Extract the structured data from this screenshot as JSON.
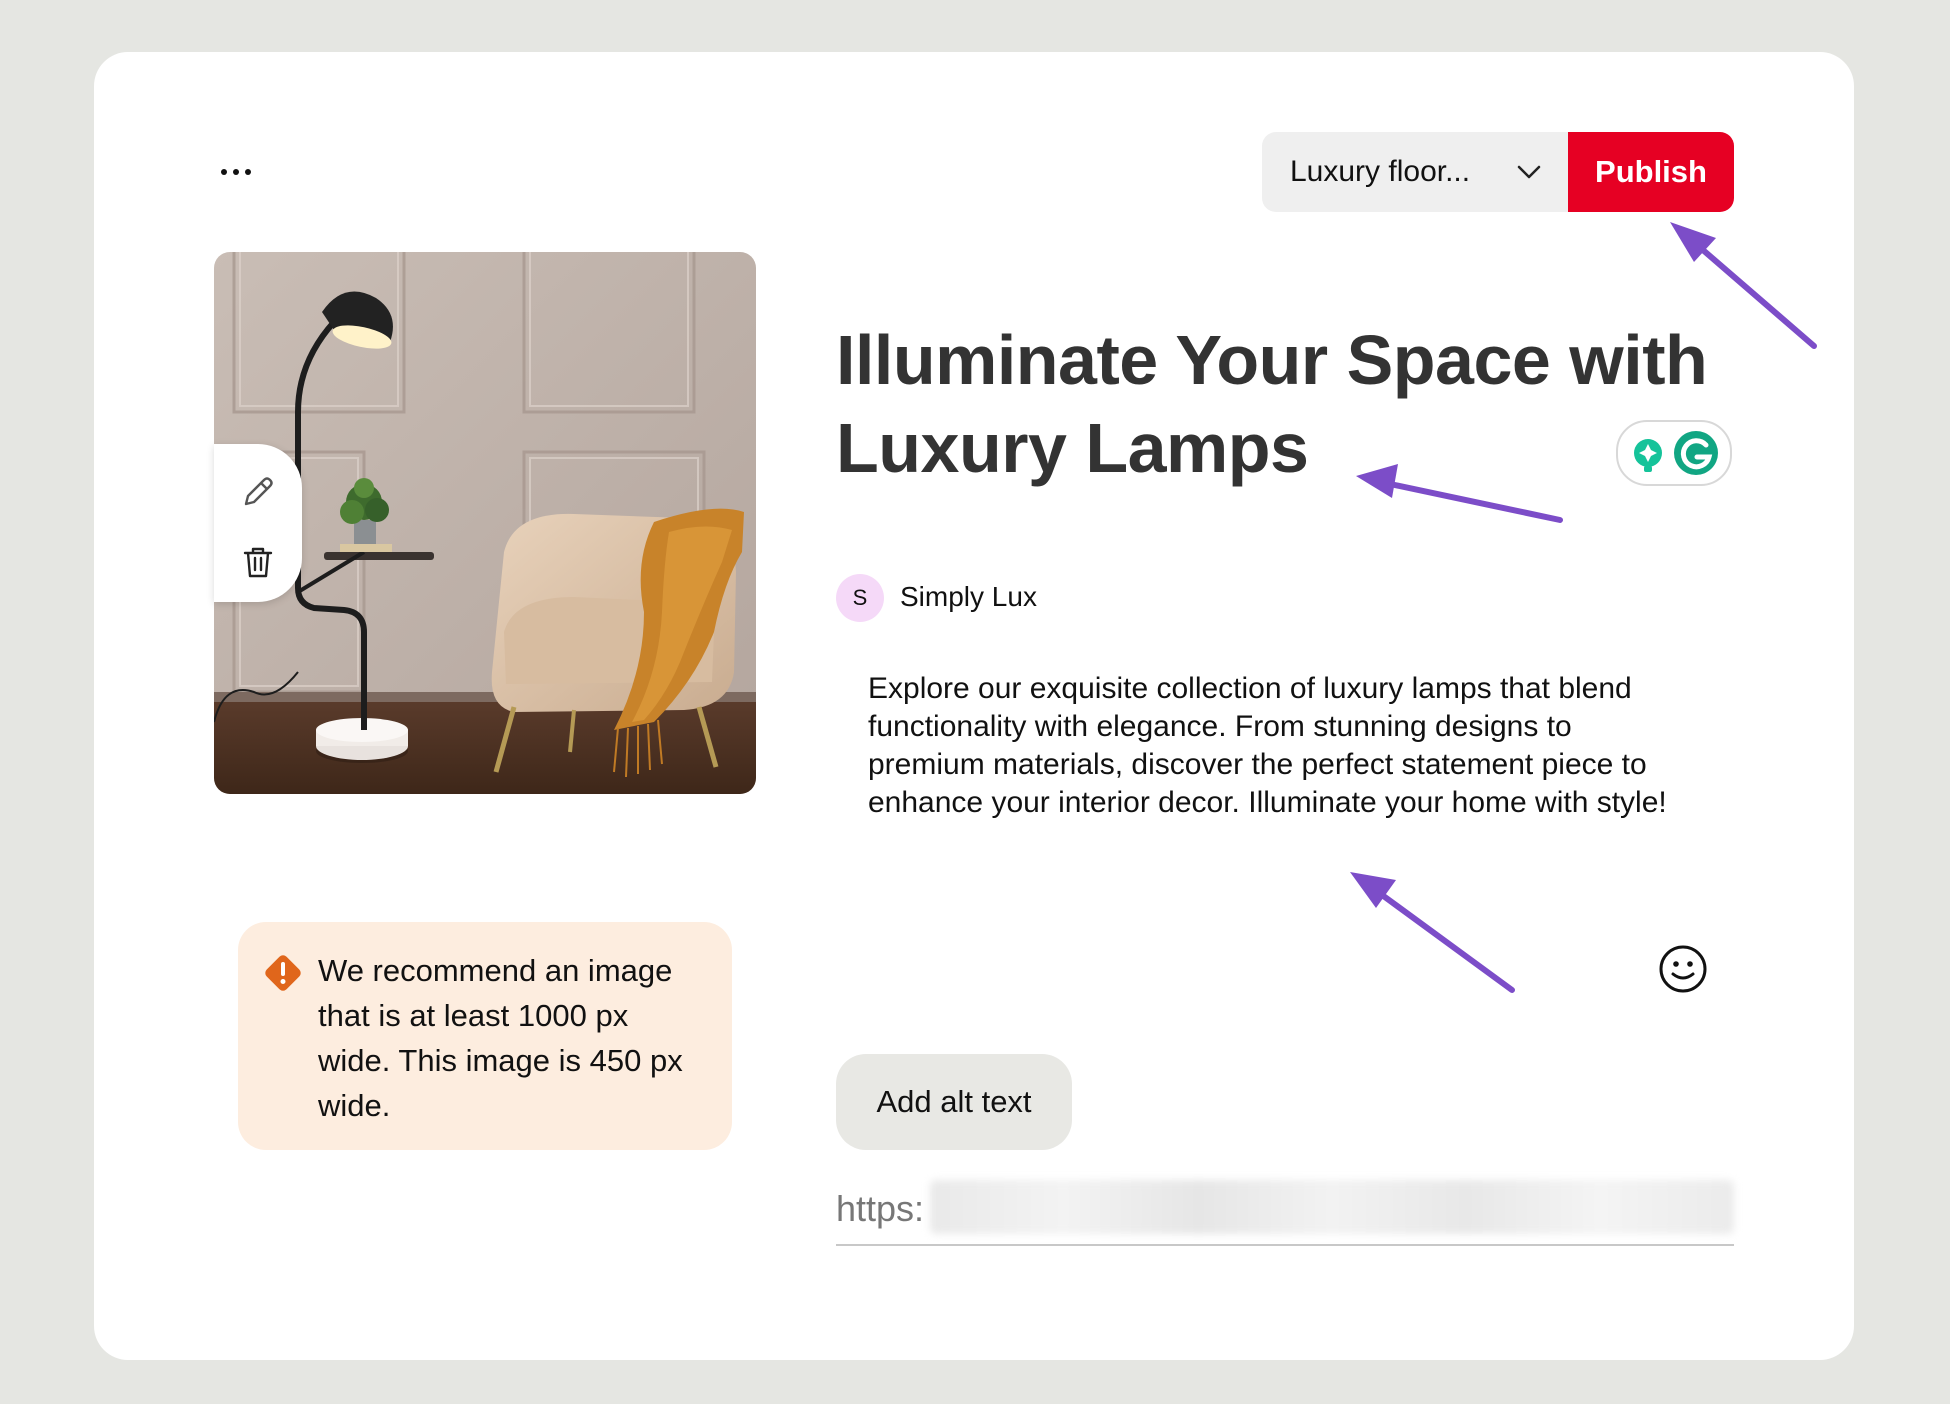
{
  "toolbar": {
    "more_label": "More options",
    "board_select_value": "Luxury floor...",
    "publish_label": "Publish"
  },
  "pin": {
    "title": "Illuminate Your Space with Luxury Lamps",
    "author_initial": "S",
    "author_name": "Simply Lux",
    "description": "Explore our exquisite collection of luxury lamps that blend functionality with elegance. From stunning designs to premium materials, discover the perfect statement piece to enhance your interior decor. Illuminate your home with style!",
    "alt_text_button": "Add alt text",
    "link_prefix": "https:"
  },
  "warning": {
    "text": "We recommend an image that is at least 1000 px wide. This image is 450 px wide."
  },
  "icons": {
    "more": "ellipsis-icon",
    "chevron": "chevron-down-icon",
    "edit": "pencil-icon",
    "delete": "trash-icon",
    "warning": "warning-icon",
    "grammarly": "grammarly-icon",
    "emoji": "emoji-icon"
  },
  "colors": {
    "publish": "#e60023",
    "warning_bg": "#fdeddf",
    "warning_icon": "#e0661b",
    "annotation_arrow": "#7c4dc8",
    "avatar_bg": "#f5d9f8"
  }
}
